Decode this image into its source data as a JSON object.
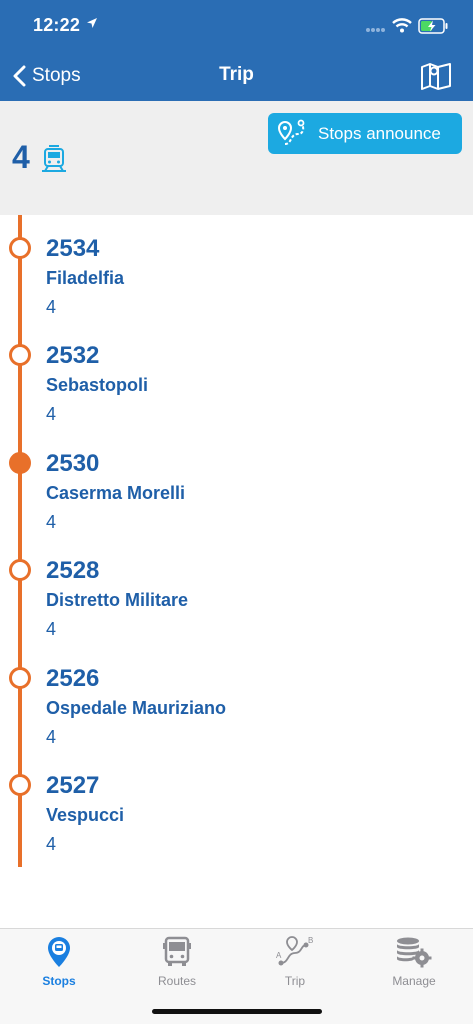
{
  "status": {
    "time": "12:22"
  },
  "nav": {
    "back_label": "Stops",
    "title": "Trip"
  },
  "route": {
    "number": "4"
  },
  "announce": {
    "label": "Stops announce"
  },
  "stops": [
    {
      "code": "2534",
      "name": "Filadelfia",
      "route": "4",
      "current": false
    },
    {
      "code": "2532",
      "name": "Sebastopoli",
      "route": "4",
      "current": false
    },
    {
      "code": "2530",
      "name": "Caserma Morelli",
      "route": "4",
      "current": true
    },
    {
      "code": "2528",
      "name": "Distretto Militare",
      "route": "4",
      "current": false
    },
    {
      "code": "2526",
      "name": "Ospedale Mauriziano",
      "route": "4",
      "current": false
    },
    {
      "code": "2527",
      "name": "Vespucci",
      "route": "4",
      "current": false
    }
  ],
  "tabs": [
    {
      "label": "Stops",
      "icon": "bus-stop-pin-icon",
      "active": true
    },
    {
      "label": "Routes",
      "icon": "bus-icon",
      "active": false
    },
    {
      "label": "Trip",
      "icon": "route-a-b-icon",
      "active": false
    },
    {
      "label": "Manage",
      "icon": "database-gear-icon",
      "active": false
    }
  ],
  "colors": {
    "primary": "#2a6db4",
    "accent_orange": "#e8702a",
    "announce_blue": "#1ca9e1",
    "text_blue": "#1f5fa8",
    "tab_active": "#1a7fe0"
  }
}
